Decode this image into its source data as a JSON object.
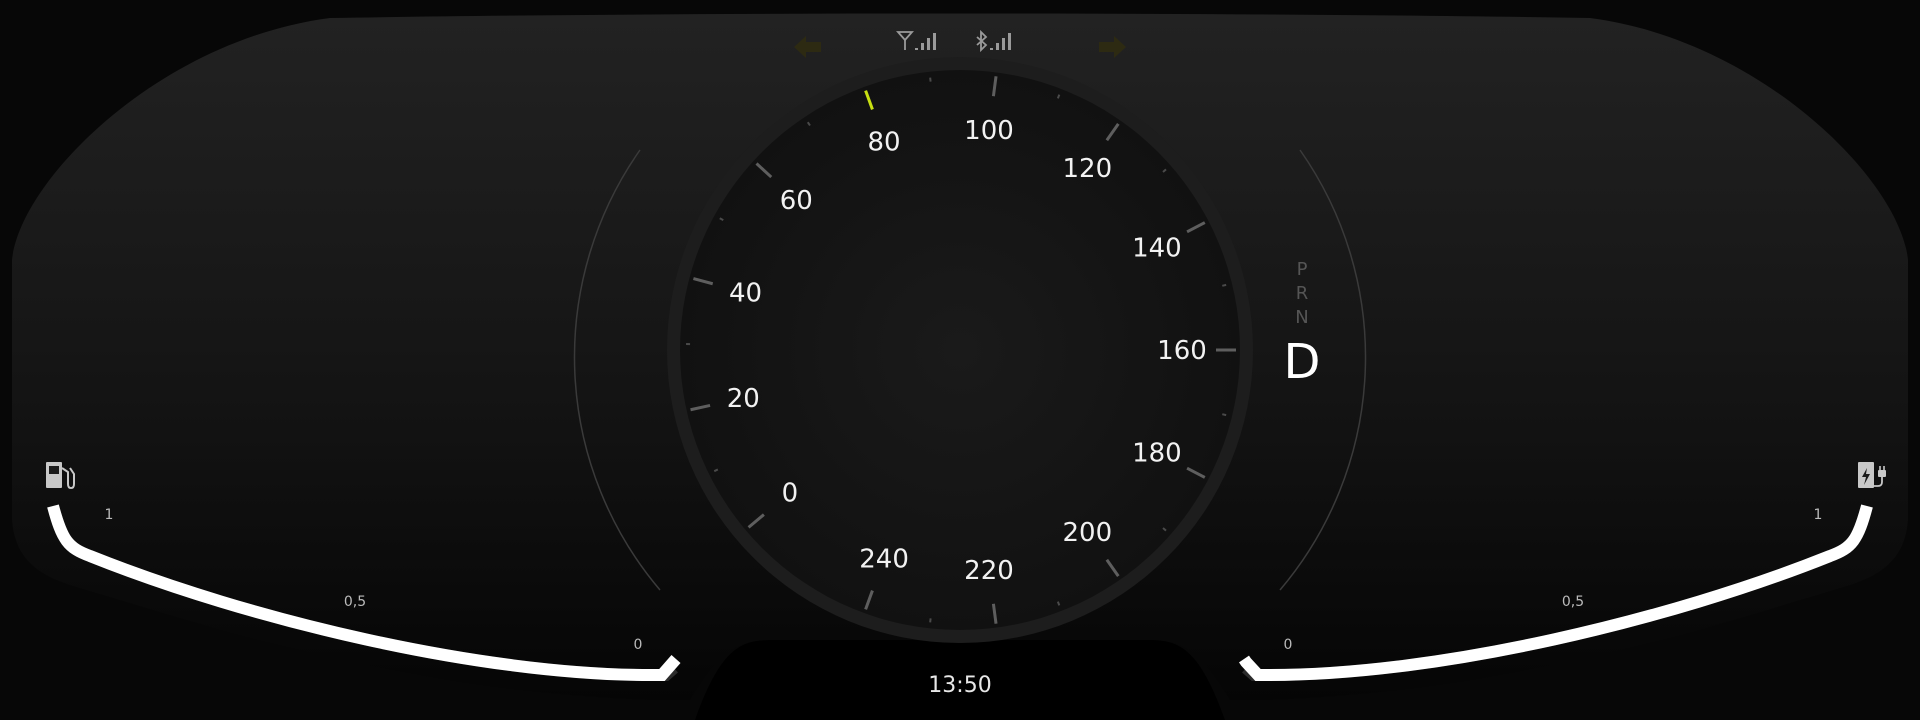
{
  "status_bar": {
    "left_arrow_icon": "arrow-left-icon",
    "right_arrow_icon": "arrow-right-icon",
    "signal_icon": "antenna-signal-icon",
    "bluetooth_icon": "bluetooth-signal-icon",
    "arrow_color": "#2d2a12"
  },
  "speedometer": {
    "labels": [
      "0",
      "20",
      "40",
      "60",
      "80",
      "100",
      "120",
      "140",
      "160",
      "180",
      "200",
      "220",
      "240"
    ],
    "max": 240,
    "current_speed": 80,
    "marker_color": "#c8e012"
  },
  "gear_selector": {
    "gears": [
      "P",
      "R",
      "N"
    ],
    "active": "D"
  },
  "left_gauge": {
    "icon": "fuel-pump-icon",
    "labels": {
      "full": "1",
      "half": "0,5",
      "empty": "0"
    },
    "level": 1.0
  },
  "right_gauge": {
    "icon": "ev-charger-icon",
    "labels": {
      "full": "1",
      "half": "0,5",
      "empty": "0"
    },
    "level": 1.0
  },
  "clock": {
    "time": "13:50"
  }
}
